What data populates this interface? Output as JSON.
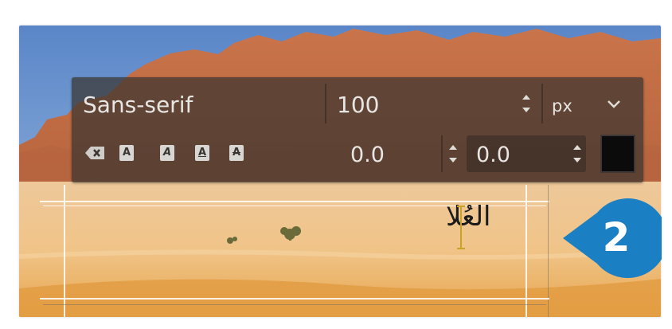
{
  "toolbar": {
    "font_name": "Sans-serif",
    "font_size": "100",
    "unit": "px",
    "baseline_offset": "0.0",
    "kerning": "0.0",
    "text_color": "#000000",
    "clear_style_icon": "eraser-icon",
    "format_buttons": [
      {
        "name": "bold-icon",
        "glyph": "A"
      },
      {
        "name": "italic-icon",
        "glyph": "A"
      },
      {
        "name": "underline-icon",
        "glyph": "A"
      },
      {
        "name": "strikethrough-icon",
        "glyph": "A"
      }
    ]
  },
  "canvas": {
    "text_layer_content": "العُلا"
  },
  "callout": {
    "number": "2",
    "color": "#1b7fc4"
  }
}
